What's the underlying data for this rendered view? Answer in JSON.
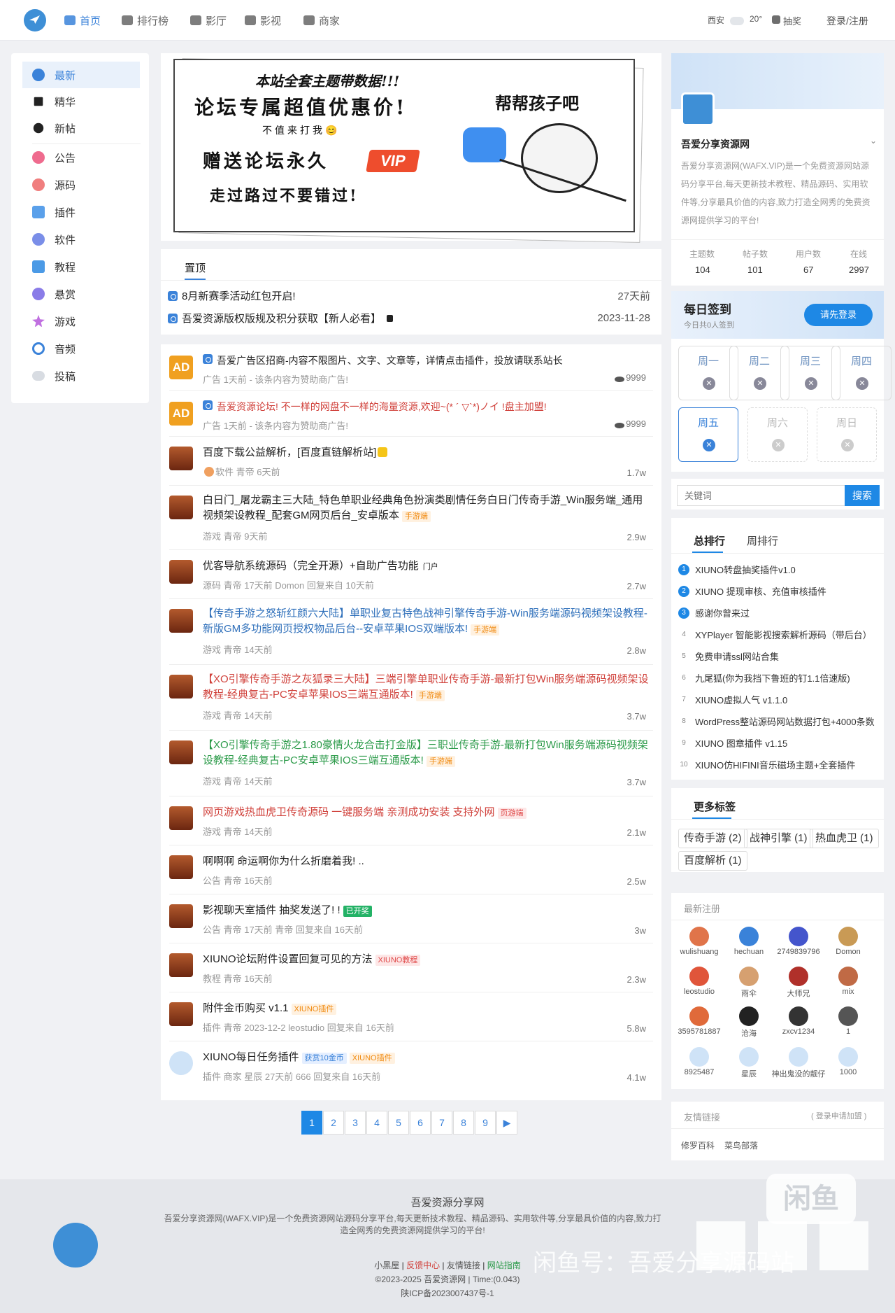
{
  "header": {
    "nav": [
      {
        "label": "首页",
        "active": true
      },
      {
        "label": "排行榜"
      },
      {
        "label": "影厅"
      },
      {
        "label": "影视"
      },
      {
        "label": "商家"
      }
    ],
    "city": "西安",
    "temp": "20°",
    "lottery": "抽奖",
    "login": "登录/注册"
  },
  "sidebar": {
    "items": [
      "最新",
      "精华",
      "新帖",
      "公告",
      "源码",
      "插件",
      "软件",
      "教程",
      "悬赏",
      "游戏",
      "音频",
      "投稿"
    ]
  },
  "banner": {
    "line1": "本站全套主题带数据!!!",
    "line2": "论坛专属超值优惠价!",
    "line3": "不值来打我😊",
    "line4": "赠送论坛永久",
    "vip": "VIP",
    "line5": "走过路过不要错过!",
    "right": "帮帮孩子吧"
  },
  "pinned": {
    "tab": "置顶",
    "rows": [
      {
        "title": "8月新赛季活动红包开启!",
        "time": "27天前"
      },
      {
        "title": "吾爱资源版权版规及积分获取【新人必看】",
        "time": "2023-11-28"
      }
    ]
  },
  "posts": [
    {
      "av": "AD",
      "title": "吾爱广告区招商-内容不限图片、文字、文章等，详情点击插件，投放请联系站长",
      "meta": "广告 1天前  - 该条内容为赞助商广告!",
      "views": "9999",
      "color": ""
    },
    {
      "av": "AD",
      "title": "吾爱资源论坛!  不一样的网盘不一样的海量资源,欢迎~(* ´ ▽`*)ノイ !盘主加盟!",
      "meta": "广告 1天前  - 该条内容为赞助商广告!",
      "views": "9999",
      "color": "red"
    },
    {
      "title": "百度下载公益解析，[百度直链解析站]",
      "meta": "软件  青帝  6天前",
      "views": "1.7w"
    },
    {
      "title": "白日门_屠龙霸主三大陆_特色单职业经典角色扮演类剧情任务白日门传奇手游_Win服务端_通用视频架设教程_配套GM网页后台_安卓版本",
      "tag": "手游端",
      "meta": "游戏  青帝  9天前",
      "views": "2.9w"
    },
    {
      "title": "优客导航系统源码（完全开源）+自助广告功能",
      "tag": "门户",
      "meta": "源码  青帝  17天前  Domon 回复来自 10天前",
      "views": "2.7w"
    },
    {
      "title": "【传奇手游之怒斩红颜六大陆】单职业复古特色战神引擎传奇手游-Win服务端源码视频架设教程-新版GM多功能网页授权物品后台--安卓苹果IOS双端版本!",
      "tag": "手游端",
      "meta": "游戏  青帝  14天前",
      "views": "2.8w",
      "color": "blue"
    },
    {
      "title": "【XO引擎传奇手游之灰狐录三大陆】三端引擎单职业传奇手游-最新打包Win服务端源码视频架设教程-经典复古-PC安卓苹果IOS三端互通版本!",
      "tag": "手游端",
      "meta": "游戏  青帝  14天前",
      "views": "3.7w",
      "color": "red"
    },
    {
      "title": "【XO引擎传奇手游之1.80豪情火龙合击打金版】三职业传奇手游-最新打包Win服务端源码视频架设教程-经典复古-PC安卓苹果IOS三端互通版本!",
      "tag": "手游端",
      "meta": "游戏  青帝  14天前",
      "views": "3.7w",
      "color": "green"
    },
    {
      "title": "网页游戏热血虎卫传奇源码 一键服务端 亲测成功安装 支持外网",
      "tag": "页游端",
      "meta": "游戏  青帝  14天前",
      "views": "2.1w",
      "color": "red"
    },
    {
      "title": "啊啊啊 命运啊你为什么折磨着我! ..",
      "meta": "公告  青帝  16天前",
      "views": "2.5w"
    },
    {
      "title": "影视聊天室插件 抽奖发送了! !",
      "tag": "已开奖",
      "meta": "公告  青帝  17天前  青帝 回复来自 16天前",
      "views": "3w"
    },
    {
      "title": "XIUNO论坛附件设置回复可见的方法",
      "tag": "XIUNO教程",
      "meta": "教程  青帝  16天前",
      "views": "2.3w"
    },
    {
      "title": "附件金币购买 v1.1",
      "tag": "XIUNO插件",
      "meta": "插件  青帝  2023-12-2  leostudio 回复来自 16天前",
      "views": "5.8w"
    },
    {
      "title": "XIUNO每日任务插件",
      "tag": "获赏10金币",
      "tag2": "XIUNO插件",
      "meta": "插件  商家 星辰  27天前  666 回复来自 16天前",
      "views": "4.1w"
    }
  ],
  "pages": [
    "1",
    "2",
    "3",
    "4",
    "5",
    "6",
    "7",
    "8",
    "9",
    "▶"
  ],
  "site": {
    "name": "吾爱分享资源网",
    "desc": "吾爱分享资源网(WAFX.VIP)是一个免费资源网站源码分享平台,每天更新技术教程、精品源码、实用软件等,分享最具价值的内容,致力打造全网秀的免费资源网提供学习的平台!",
    "stats": [
      {
        "l": "主题数",
        "v": "104"
      },
      {
        "l": "帖子数",
        "v": "101"
      },
      {
        "l": "用户数",
        "v": "67"
      },
      {
        "l": "在线",
        "v": "2997"
      }
    ]
  },
  "checkin": {
    "title": "每日签到",
    "sub": "今日共0人签到",
    "btn": "请先登录",
    "days": [
      "周一",
      "周二",
      "周三",
      "周四",
      "周五",
      "周六",
      "周日"
    ]
  },
  "search": {
    "placeholder": "关键词",
    "btn": "搜索"
  },
  "rank": {
    "tabs": [
      "总排行",
      "周排行"
    ],
    "items": [
      "XIUNO转盘抽奖插件v1.0",
      "XIUNO 提现审核、充值审核插件",
      "感谢你曾来过",
      "XYPlayer 智能影视搜索解析源码（带后台）",
      "免费申请ssl网站合集",
      "九尾狐(你为我挡下鲁班的钉1.1倍速版)",
      "XIUNO虚拟人气 v1.1.0",
      "WordPress整站源码网站数据打包+4000条数",
      "XIUNO 图章插件 v1.15",
      "XIUNO仿HIFINI音乐磁场主题+全套插件"
    ]
  },
  "tags": {
    "title": "更多标签",
    "items": [
      "传奇手游 (2)",
      "战神引擎 (1)",
      "热血虎卫 (1)",
      "百度解析 (1)"
    ]
  },
  "users": {
    "title": "最新注册",
    "items": [
      "wulishuang",
      "hechuan",
      "2749839796",
      "Domon",
      "leostudio",
      "雨伞",
      "大师兄",
      "mix",
      "3595781887",
      "沧海",
      "zxcv1234",
      "1",
      "8925487",
      "星辰",
      "神出鬼没的靓仔",
      "1000"
    ]
  },
  "links": {
    "title": "友情链接",
    "apply": "( 登录申请加盟 )",
    "items": [
      "修罗百科",
      "菜鸟部落"
    ]
  },
  "footer": {
    "name": "吾爱资源分享网",
    "desc": "吾爱分享资源网(WAFX.VIP)是一个免费资源网站源码分享平台,每天更新技术教程、精品源码、实用软件等,分享最具价值的内容,致力打造全网秀的免费资源网提供学习的平台!",
    "links": [
      "小黑屋",
      "反馈中心",
      "友情链接",
      "网站指南"
    ],
    "copy": "©2023-2025 吾爱资源网 | Time:(0.043)",
    "icp": "陕ICP备2023007437号-1",
    "watermark": "闲鱼号：吾爱分享源码站",
    "logo": "闲鱼"
  }
}
